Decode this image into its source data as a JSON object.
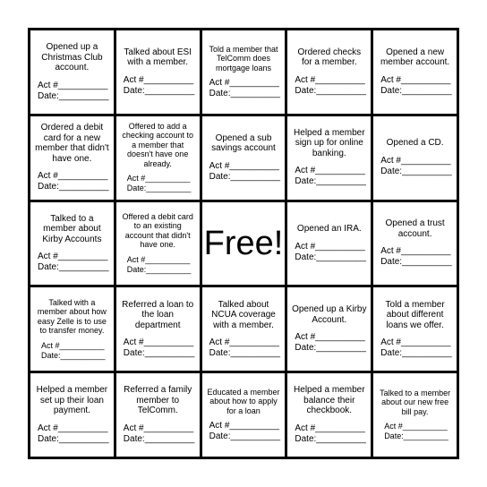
{
  "card": {
    "field_labels": {
      "act": "Act #__________",
      "date": "Date:__________"
    },
    "free_label": "Free!",
    "cells": [
      {
        "task": "Opened up a Christmas Club account."
      },
      {
        "task": "Talked about ESI with a member."
      },
      {
        "task": "Told a member that TelComm does mortgage loans"
      },
      {
        "task": "Ordered checks for a member."
      },
      {
        "task": "Opened a new member account."
      },
      {
        "task": "Ordered a debit card for a new member that didn't have one."
      },
      {
        "task": "Offered to add a checking account to a member that doesn't have one already."
      },
      {
        "task": "Opened a sub savings account"
      },
      {
        "task": "Helped a member sign up for online banking."
      },
      {
        "task": "Opened a CD."
      },
      {
        "task": "Talked to a member about Kirby Accounts"
      },
      {
        "task": "Offered a debit card to an existing account that didn't have one."
      },
      {
        "task": "Free!",
        "free": true
      },
      {
        "task": "Opened an IRA."
      },
      {
        "task": "Opened a trust account."
      },
      {
        "task": "Talked with a member about how easy Zelle is to use to transfer money."
      },
      {
        "task": "Referred a loan to the loan department"
      },
      {
        "task": "Talked about NCUA coverage with a member."
      },
      {
        "task": "Opened up a Kirby Account."
      },
      {
        "task": "Told a member about different loans we offer."
      },
      {
        "task": "Helped a member set up their loan payment."
      },
      {
        "task": "Referred a family member to TelComm."
      },
      {
        "task": "Educated a member about how to apply for a loan"
      },
      {
        "task": "Helped a member balance their checkbook."
      },
      {
        "task": "Talked to a member about our new free bill pay."
      }
    ]
  }
}
